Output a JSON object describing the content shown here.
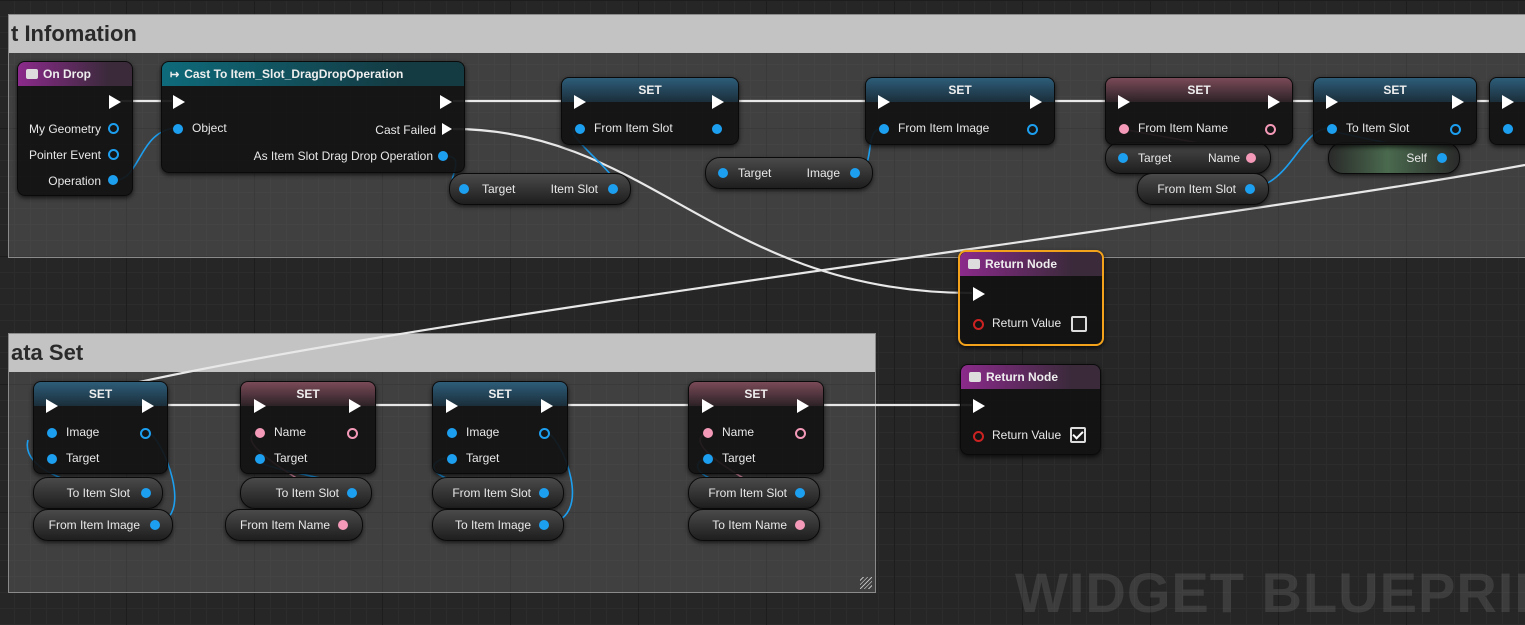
{
  "comments": {
    "top_title": "t Infomation",
    "bottom_title": "ata Set"
  },
  "watermark": "WIDGET BLUEPRINT",
  "on_drop": {
    "title": "On Drop",
    "pins": [
      "My Geometry",
      "Pointer Event",
      "Operation"
    ]
  },
  "cast": {
    "title": "Cast To Item_Slot_DragDropOperation",
    "object": "Object",
    "cast_failed": "Cast Failed",
    "as_output": "As Item Slot Drag Drop Operation"
  },
  "set_label": "SET",
  "top_sets": [
    {
      "pin": "From Item Slot"
    },
    {
      "pin": "From Item Image"
    },
    {
      "pin": "From Item Name"
    },
    {
      "pin": "To Item Slot"
    }
  ],
  "getters_top": [
    {
      "target": "Target",
      "value": "Item Slot"
    },
    {
      "target": "Target",
      "value": "Image"
    },
    {
      "target": "Target",
      "value": "Name"
    },
    {
      "value": "From Item Slot"
    },
    {
      "value": "Self"
    }
  ],
  "return_nodes": [
    {
      "title": "Return Node",
      "label": "Return Value",
      "checked": false
    },
    {
      "title": "Return Node",
      "label": "Return Value",
      "checked": true
    }
  ],
  "bottom_sets": [
    {
      "pin": "Image",
      "target": "Target",
      "g1": "To Item Slot",
      "g2": "From Item Image"
    },
    {
      "pin": "Name",
      "target": "Target",
      "g1": "To Item Slot",
      "g2": "From Item Name"
    },
    {
      "pin": "Image",
      "target": "Target",
      "g1": "From Item Slot",
      "g2": "To Item Image"
    },
    {
      "pin": "Name",
      "target": "Target",
      "g1": "From Item Slot",
      "g2": "To Item Name"
    }
  ]
}
